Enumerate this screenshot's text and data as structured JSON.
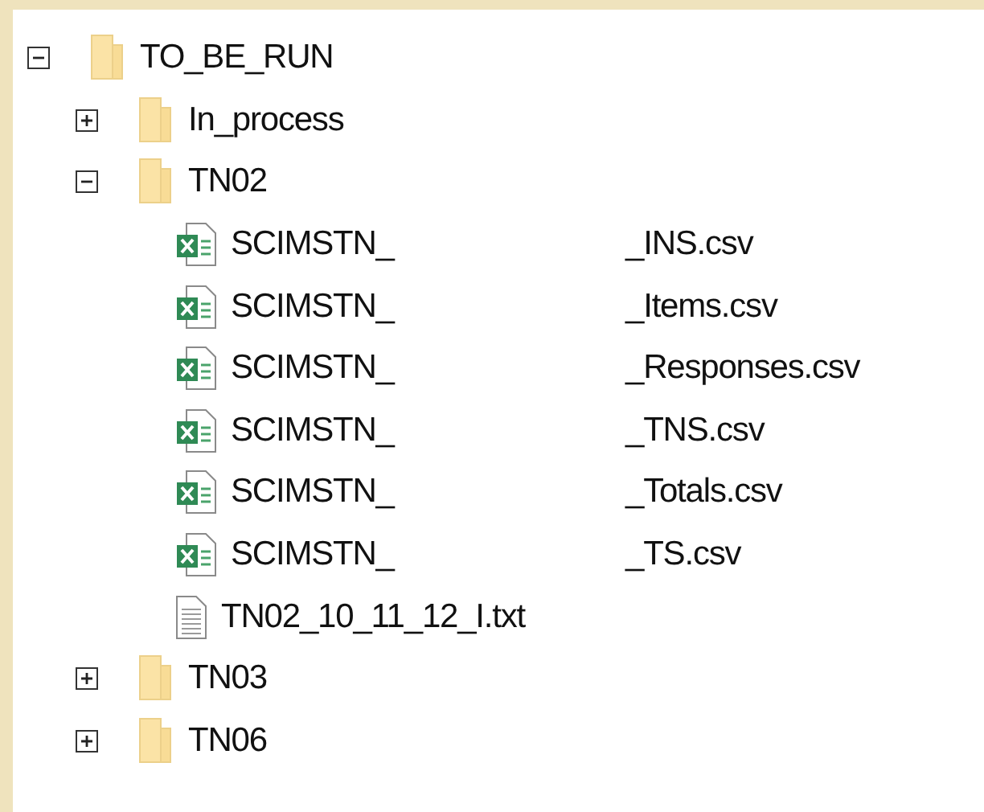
{
  "tree": [
    {
      "kind": "folder",
      "name": "TO_BE_RUN",
      "expanded": true,
      "children": [
        {
          "kind": "folder",
          "name": "In_process",
          "expanded": false
        },
        {
          "kind": "folder",
          "name": "TN02",
          "expanded": true,
          "children": [
            {
              "kind": "spreadsheet",
              "name": "SCIMSTN_",
              "name_end": "_INS.csv"
            },
            {
              "kind": "spreadsheet",
              "name": "SCIMSTN_",
              "name_end": "_Items.csv"
            },
            {
              "kind": "spreadsheet",
              "name": "SCIMSTN_",
              "name_end": "_Responses.csv"
            },
            {
              "kind": "spreadsheet",
              "name": "SCIMSTN_",
              "name_end": "_TNS.csv"
            },
            {
              "kind": "spreadsheet",
              "name": "SCIMSTN_",
              "name_end": "_Totals.csv"
            },
            {
              "kind": "spreadsheet",
              "name": "SCIMSTN_",
              "name_end": "_TS.csv"
            },
            {
              "kind": "text",
              "name": "TN02_10_11_12_I.txt"
            }
          ]
        },
        {
          "kind": "folder",
          "name": "TN03",
          "expanded": false
        },
        {
          "kind": "folder",
          "name": "TN06",
          "expanded": false
        }
      ]
    }
  ]
}
